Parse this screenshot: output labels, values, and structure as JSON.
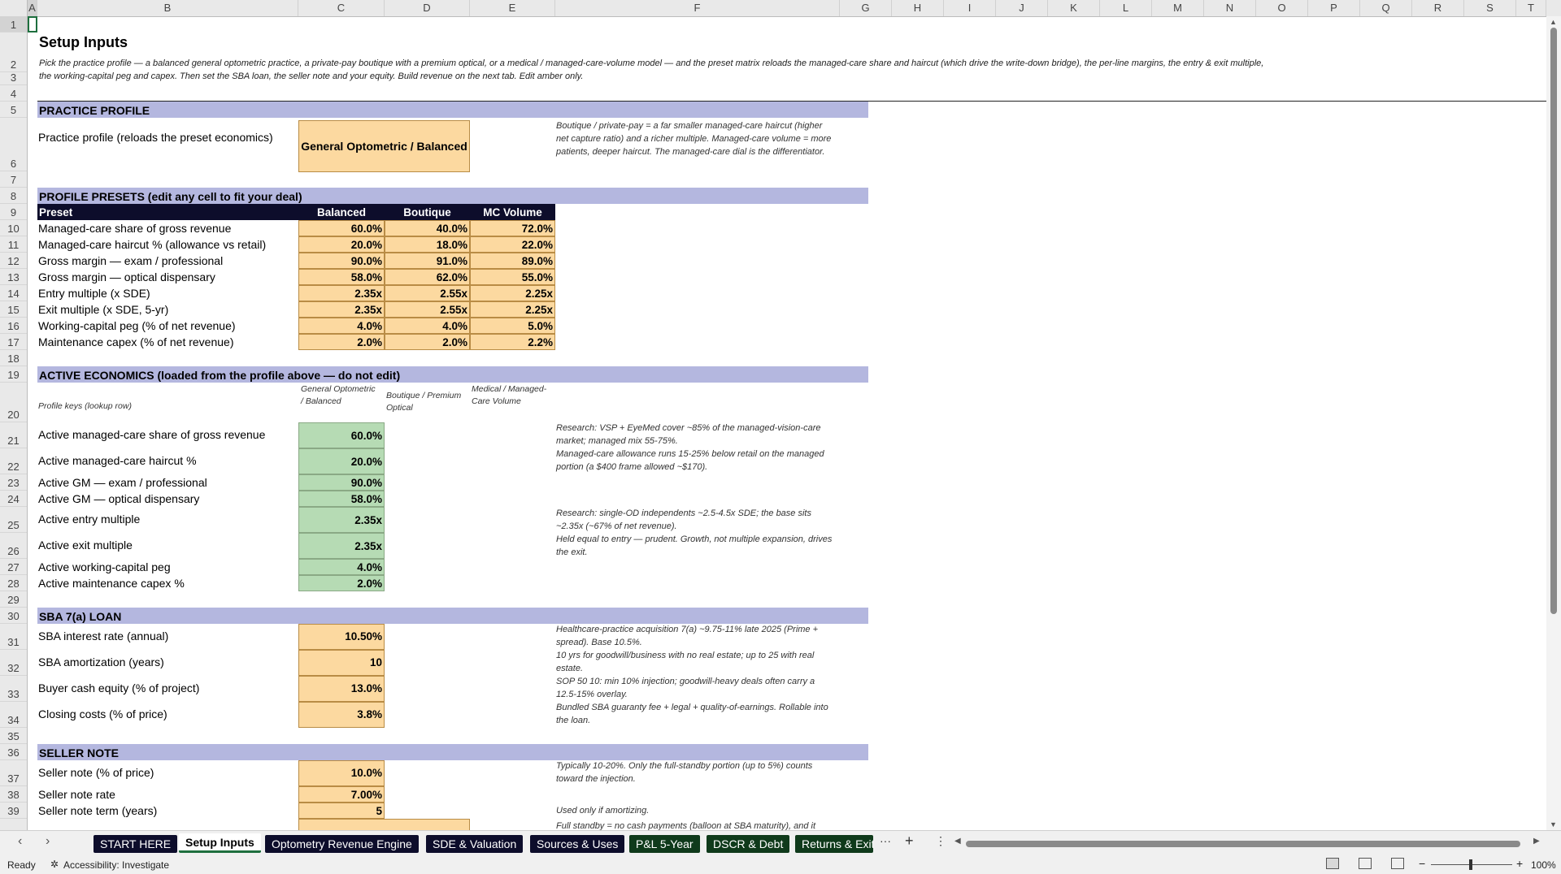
{
  "columns": [
    "A",
    "B",
    "C",
    "D",
    "E",
    "F",
    "G",
    "H",
    "I",
    "J",
    "K",
    "L",
    "M",
    "N",
    "O",
    "P",
    "Q",
    "R",
    "S",
    "T"
  ],
  "rows": [
    "1",
    "2",
    "3",
    "4",
    "5",
    "6",
    "7",
    "8",
    "9",
    "10",
    "11",
    "12",
    "13",
    "14",
    "15",
    "16",
    "17",
    "18",
    "19",
    "20",
    "21",
    "22",
    "23",
    "24",
    "25",
    "26",
    "27",
    "28",
    "29",
    "30",
    "31",
    "32",
    "33",
    "34",
    "35",
    "36",
    "37",
    "38",
    "39"
  ],
  "title": "Setup Inputs",
  "intro": "Pick the practice profile — a balanced general optometric practice, a private-pay boutique with a premium optical, or a medical / managed-care-volume model — and the preset matrix reloads the managed-care share and haircut (which drive the write-down bridge), the per-line margins, the entry & exit multiple, the working-capital peg and capex. Then set the SBA loan, the seller note and your equity. Build revenue on the next tab. Edit amber only.",
  "sections": {
    "practice_profile": "PRACTICE PROFILE",
    "presets": "PROFILE PRESETS  (edit any cell to fit your deal)",
    "active": "ACTIVE ECONOMICS  (loaded from the profile above — do not edit)",
    "sba": "SBA 7(a) LOAN",
    "seller": "SELLER NOTE"
  },
  "profile": {
    "label": "Practice profile (reloads the preset economics)",
    "value": "General Optometric / Balanced",
    "note": "Boutique / private-pay = a far smaller managed-care haircut (higher net capture ratio) and a richer multiple. Managed-care volume = more patients, deeper haircut. The managed-care dial is the differentiator."
  },
  "presets": {
    "headers": [
      "Preset",
      "Balanced",
      "Boutique",
      "MC Volume"
    ],
    "rows": [
      {
        "label": "Managed-care share of gross revenue",
        "v": [
          "60.0%",
          "40.0%",
          "72.0%"
        ]
      },
      {
        "label": "Managed-care haircut % (allowance vs retail)",
        "v": [
          "20.0%",
          "18.0%",
          "22.0%"
        ]
      },
      {
        "label": "Gross margin — exam / professional",
        "v": [
          "90.0%",
          "91.0%",
          "89.0%"
        ]
      },
      {
        "label": "Gross margin — optical dispensary",
        "v": [
          "58.0%",
          "62.0%",
          "55.0%"
        ]
      },
      {
        "label": "Entry multiple (x SDE)",
        "v": [
          "2.35x",
          "2.55x",
          "2.25x"
        ]
      },
      {
        "label": "Exit multiple (x SDE, 5-yr)",
        "v": [
          "2.35x",
          "2.55x",
          "2.25x"
        ]
      },
      {
        "label": "Working-capital peg (% of net revenue)",
        "v": [
          "4.0%",
          "4.0%",
          "5.0%"
        ]
      },
      {
        "label": "Maintenance capex (% of net revenue)",
        "v": [
          "2.0%",
          "2.0%",
          "2.2%"
        ]
      }
    ]
  },
  "active": {
    "keys_label": "Profile keys (lookup row)",
    "keys": [
      "General Optometric / Balanced",
      "Boutique / Premium Optical",
      "Medical / Managed-Care Volume"
    ],
    "rows": [
      {
        "label": "Active managed-care share of gross revenue",
        "v": "60.0%"
      },
      {
        "label": "Active managed-care haircut %",
        "v": "20.0%"
      },
      {
        "label": "Active GM — exam / professional",
        "v": "90.0%"
      },
      {
        "label": "Active GM — optical dispensary",
        "v": "58.0%"
      },
      {
        "label": "Active entry multiple",
        "v": "2.35x"
      },
      {
        "label": "Active exit multiple",
        "v": "2.35x"
      },
      {
        "label": "Active working-capital peg",
        "v": "4.0%"
      },
      {
        "label": "Active maintenance capex %",
        "v": "2.0%"
      }
    ],
    "note1": "Research: VSP + EyeMed cover ~85% of the managed-vision-care market; managed mix 55-75%.",
    "note2": "Managed-care allowance runs 15-25% below retail on the managed portion (a $400 frame allowed ~$170).",
    "note3": "Research: single-OD independents ~2.5-4.5x SDE; the base sits ~2.35x (~67% of net revenue).",
    "note4": "Held equal to entry — prudent. Growth, not multiple expansion, drives the exit."
  },
  "sba": {
    "rows": [
      {
        "label": "SBA interest rate (annual)",
        "v": "10.50%",
        "note": "Healthcare-practice acquisition 7(a) ~9.75-11% late 2025 (Prime + spread). Base 10.5%."
      },
      {
        "label": "SBA amortization (years)",
        "v": "10",
        "note": "10 yrs for goodwill/business with no real estate; up to 25 with real estate."
      },
      {
        "label": "Buyer cash equity (% of project)",
        "v": "13.0%",
        "note": "SOP 50 10: min 10% injection; goodwill-heavy deals often carry a 12.5-15% overlay."
      },
      {
        "label": "Closing costs (% of price)",
        "v": "3.8%",
        "note": "Bundled SBA guaranty fee + legal + quality-of-earnings. Rollable into the loan."
      }
    ]
  },
  "seller": {
    "rows": [
      {
        "label": "Seller note (% of price)",
        "v": "10.0%",
        "note": "Typically 10-20%. Only the full-standby portion (up to 5%) counts toward the injection."
      },
      {
        "label": "Seller note rate",
        "v": "7.00%",
        "note": ""
      },
      {
        "label": "Seller note term (years)",
        "v": "5",
        "note": "Used only if amortizing."
      }
    ],
    "note_partial": "Full standby = no cash payments (balloon at SBA maturity), and it"
  },
  "tabs": [
    "START HERE",
    "Setup Inputs",
    "Optometry Revenue Engine",
    "SDE & Valuation",
    "Sources & Uses",
    "P&L 5-Year",
    "DSCR & Debt",
    "Returns & Exit"
  ],
  "status": {
    "ready": "Ready",
    "accessibility": "Accessibility: Investigate",
    "zoom": "100%"
  }
}
